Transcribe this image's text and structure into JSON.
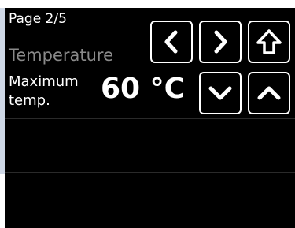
{
  "header": {
    "page_indicator": "Page 2/5",
    "section_title": "Temperature"
  },
  "navigation": {
    "prev_icon": "chevron-left-icon",
    "next_icon": "chevron-right-icon",
    "home_icon": "home-arrow-up-icon"
  },
  "parameter": {
    "label_line1": "Maximum",
    "label_line2": "temp.",
    "value": "60 °C",
    "decrease_icon": "chevron-down-icon",
    "increase_icon": "chevron-up-icon"
  },
  "colors": {
    "screen_background": "#000000",
    "foreground": "#ffffff",
    "section_title": "#8a8a8a",
    "separator": "#2a2a2a",
    "side_strip": "#cfd8e6"
  }
}
